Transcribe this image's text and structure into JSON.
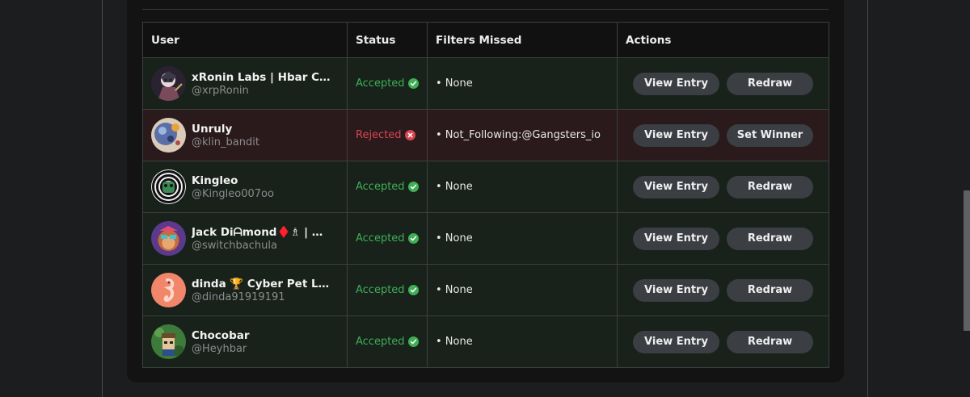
{
  "table": {
    "headers": {
      "user": "User",
      "status": "Status",
      "filters": "Filters Missed",
      "actions": "Actions"
    },
    "rows": [
      {
        "name": "xRonin Labs | Hbar Collective",
        "handle": "@xrpRonin",
        "status": "Accepted",
        "status_type": "accepted",
        "filters": "• None",
        "view_label": "View Entry",
        "second_label": "Redraw",
        "avatar_icon": "ronin-avatar-icon"
      },
      {
        "name": "Unruly",
        "handle": "@klin_bandit",
        "status": "Rejected",
        "status_type": "rejected",
        "filters": "• Not_Following:@Gangsters_io",
        "view_label": "View Entry",
        "second_label": "Set Winner",
        "avatar_icon": "planet-avatar-icon"
      },
      {
        "name": "Kingleo",
        "handle": "@Kingleo007oo",
        "status": "Accepted",
        "status_type": "accepted",
        "filters": "• None",
        "view_label": "View Entry",
        "second_label": "Redraw",
        "avatar_icon": "swirl-avatar-icon"
      },
      {
        "name": "Jack Diᗩmond♦️♗ | VSWAP",
        "handle": "@switchbachula",
        "status": "Accepted",
        "status_type": "accepted",
        "filters": "• None",
        "view_label": "View Entry",
        "second_label": "Redraw",
        "avatar_icon": "ape-avatar-icon"
      },
      {
        "name": "dinda 🏆 Cyber Pet Little",
        "handle": "@dinda91919191",
        "status": "Accepted",
        "status_type": "accepted",
        "filters": "• None",
        "view_label": "View Entry",
        "second_label": "Redraw",
        "avatar_icon": "seahorse-avatar-icon"
      },
      {
        "name": "Chocobar",
        "handle": "@Heyhbar",
        "status": "Accepted",
        "status_type": "accepted",
        "filters": "• None",
        "view_label": "View Entry",
        "second_label": "Redraw",
        "avatar_icon": "character-avatar-icon"
      }
    ]
  },
  "colors": {
    "accepted": "#3fae55",
    "rejected": "#d8454f",
    "accepted_row_bg": "#18221b",
    "rejected_row_bg": "#2a1a1c",
    "button_bg": "#3b3e43"
  }
}
